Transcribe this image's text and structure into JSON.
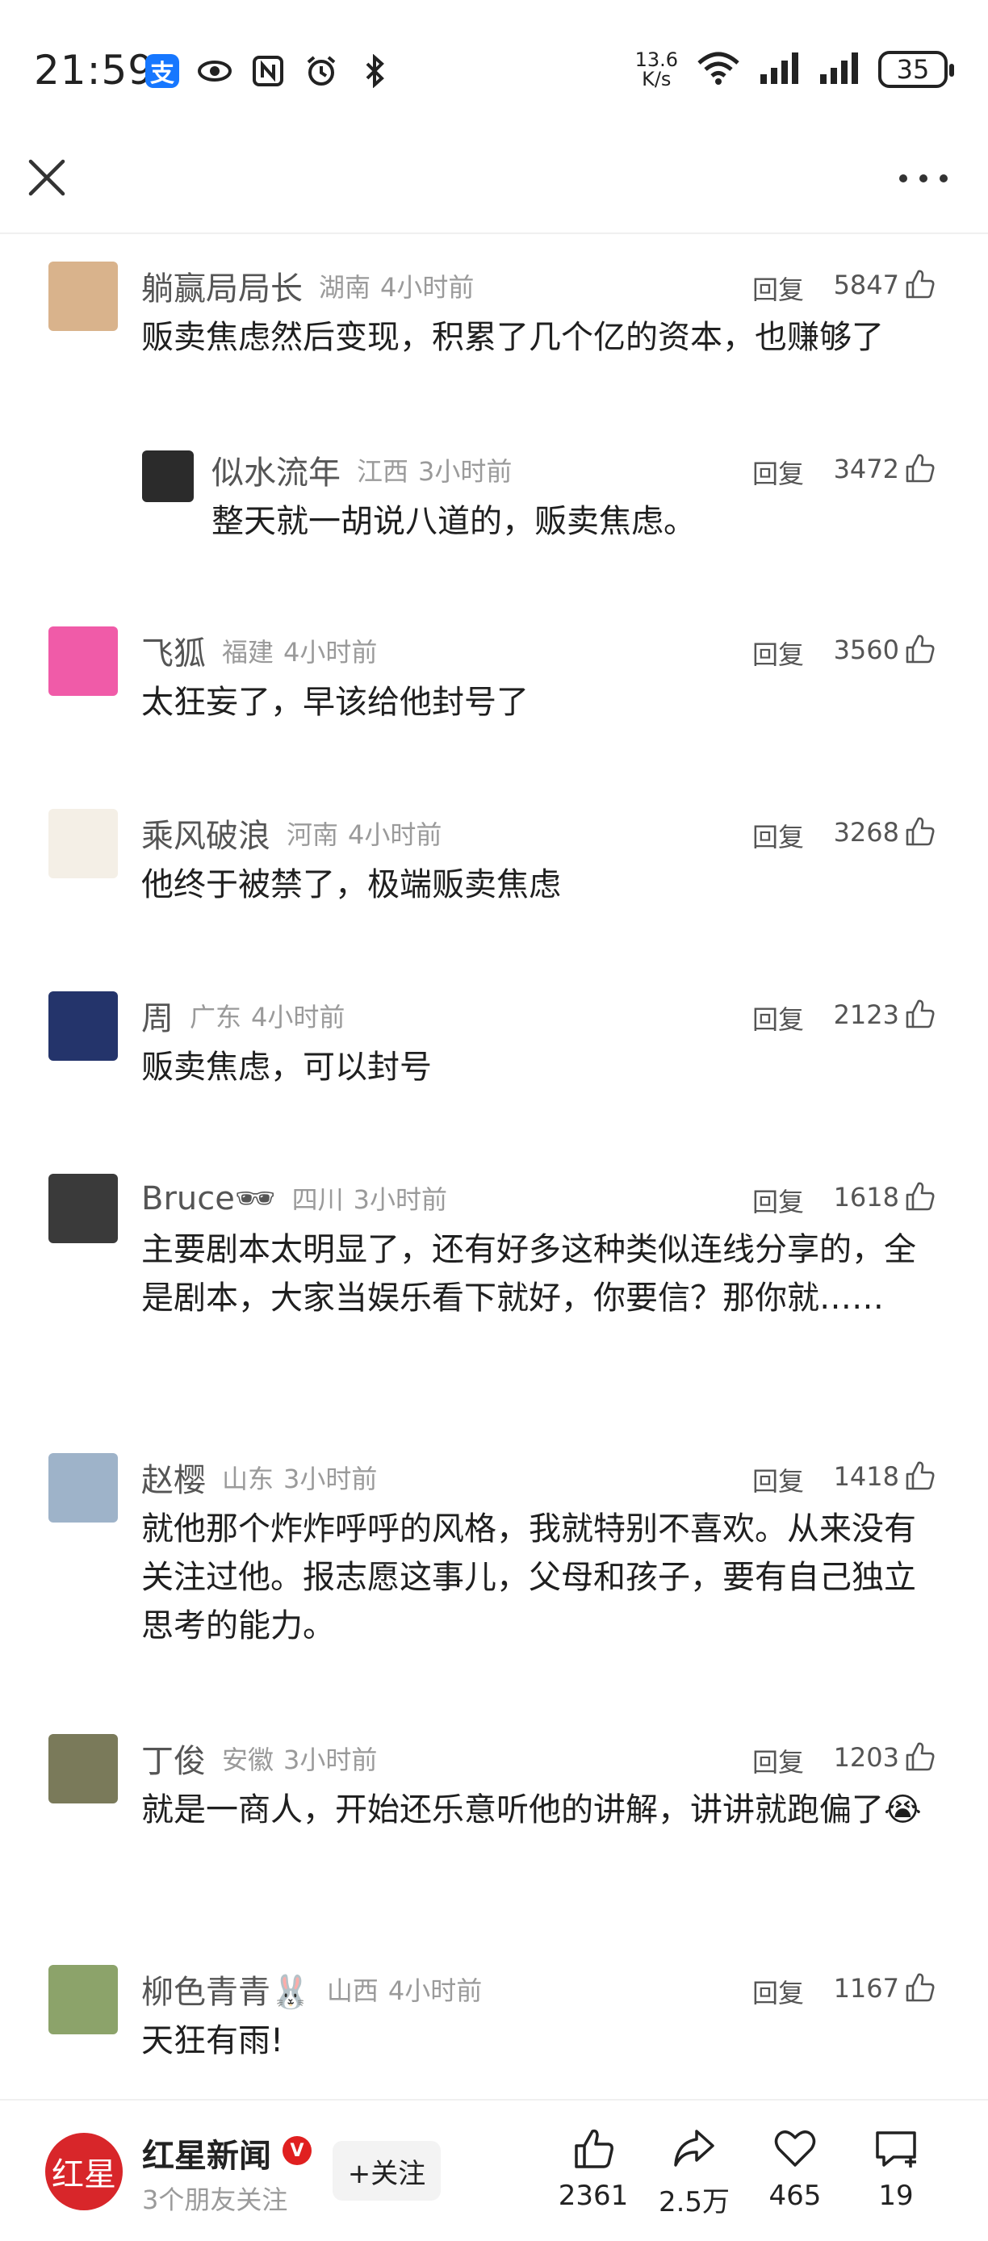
{
  "status_bar": {
    "time": "21:59",
    "alipay_glyph": "支",
    "net_speed_value": "13.6",
    "net_speed_unit": "K/s",
    "battery": "35",
    "icons_left": [
      "alipay-icon",
      "eye-icon",
      "nfc-icon",
      "alarm-icon",
      "bluetooth-icon"
    ],
    "icons_right": [
      "wifi-icon",
      "signal-icon",
      "signal-icon",
      "battery-icon"
    ]
  },
  "top_nav": {
    "close_icon": "close-icon",
    "more_icon": "more-icon"
  },
  "comments": [
    {
      "name": "躺赢局局长",
      "location": "湖南",
      "time": "4小时前",
      "reply_label": "回复",
      "likes": "5847",
      "text": "贩卖焦虑然后变现，积累了几个亿的资本，也赚够了",
      "avatar_color": "#d9b38c"
    },
    {
      "name": "似水流年",
      "location": "江西",
      "time": "3小时前",
      "reply_label": "回复",
      "likes": "3472",
      "text": "整天就一胡说八道的，贩卖焦虑。",
      "avatar_color": "#2b2b2b",
      "is_reply": true
    },
    {
      "name": "飞狐",
      "location": "福建",
      "time": "4小时前",
      "reply_label": "回复",
      "likes": "3560",
      "text": "太狂妄了，早该给他封号了",
      "avatar_color": "#f05ba8"
    },
    {
      "name": "乘风破浪",
      "location": "河南",
      "time": "4小时前",
      "reply_label": "回复",
      "likes": "3268",
      "text": "他终于被禁了，极端贩卖焦虑",
      "avatar_color": "#f4efe6"
    },
    {
      "name": "周",
      "location": "广东",
      "time": "4小时前",
      "reply_label": "回复",
      "likes": "2123",
      "text": "贩卖焦虑，可以封号",
      "avatar_color": "#24346b"
    },
    {
      "name": "Bruce🕶",
      "location": "四川",
      "time": "3小时前",
      "reply_label": "回复",
      "likes": "1618",
      "text": "主要剧本太明显了，还有好多这种类似连线分享的，全是剧本，大家当娱乐看下就好，你要信？那你就……",
      "avatar_color": "#3a3a3a"
    },
    {
      "name": "赵樱",
      "location": "山东",
      "time": "3小时前",
      "reply_label": "回复",
      "likes": "1418",
      "text": "就他那个炸炸呼呼的风格，我就特别不喜欢。从来没有关注过他。报志愿这事儿，父母和孩子，要有自己独立思考的能力。",
      "avatar_color": "#9eb3c9"
    },
    {
      "name": "丁俊",
      "location": "安徽",
      "time": "3小时前",
      "reply_label": "回复",
      "likes": "1203",
      "text": "就是一商人，开始还乐意听他的讲解，讲讲就跑偏了😭",
      "avatar_color": "#7a7a5a"
    },
    {
      "name": "柳色青青🐰",
      "location": "山西",
      "time": "4小时前",
      "reply_label": "回复",
      "likes": "1167",
      "text": "天狂有雨!",
      "avatar_color": "#8ca36a"
    }
  ],
  "bottom_bar": {
    "media_logo_text": "红星",
    "media_name": "红星新闻",
    "verified_mark": "V",
    "followers_text": "3个朋友关注",
    "follow_label": "+关注",
    "actions": [
      {
        "icon": "thumbs-up-icon",
        "count": "2361"
      },
      {
        "icon": "share-icon",
        "count": "2.5万"
      },
      {
        "icon": "heart-icon",
        "count": "465"
      },
      {
        "icon": "comment-icon",
        "count": "19"
      }
    ],
    "accent_color": "#d8262a"
  }
}
